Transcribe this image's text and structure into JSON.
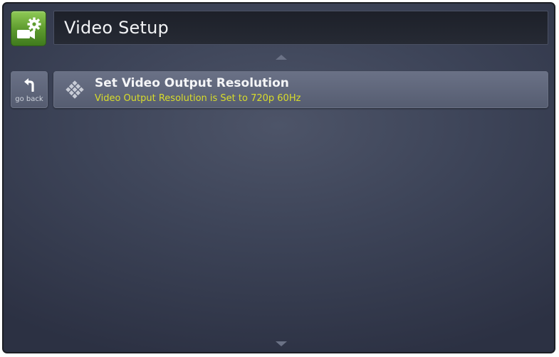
{
  "header": {
    "title": "Video Setup",
    "icon": "video-settings-icon",
    "icon_color": "#6aa83a"
  },
  "navigation": {
    "back_label": "go back",
    "back_icon": "back-arrow-icon",
    "scroll_up_icon": "scroll-up-arrow-icon",
    "scroll_down_icon": "scroll-down-arrow-icon"
  },
  "menu": {
    "items": [
      {
        "title": "Set Video Output Resolution",
        "status": "Video Output Resolution is Set to 720p 60Hz",
        "icon": "diamond-grid-icon",
        "status_color": "#d9dd2a"
      }
    ]
  },
  "theme": {
    "background": "#3d4458",
    "button_fill": "#60677b",
    "title_bar": "#22252e"
  }
}
